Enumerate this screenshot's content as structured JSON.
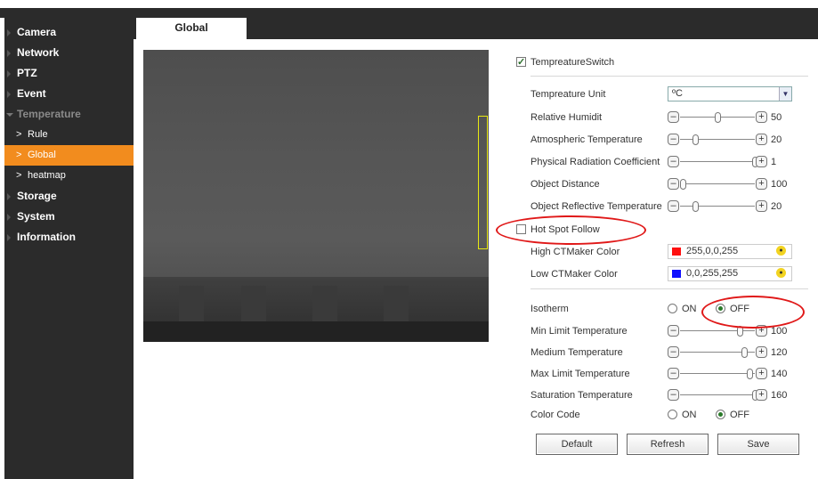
{
  "sidebar": {
    "items": [
      {
        "label": "Camera"
      },
      {
        "label": "Network"
      },
      {
        "label": "PTZ"
      },
      {
        "label": "Event"
      },
      {
        "label": "Temperature"
      }
    ],
    "sub_items": [
      {
        "label": "Rule"
      },
      {
        "label": "Global"
      },
      {
        "label": "heatmap"
      }
    ],
    "bottom_items": [
      {
        "label": "Storage"
      },
      {
        "label": "System"
      },
      {
        "label": "Information"
      }
    ]
  },
  "tabs": [
    {
      "label": "Global"
    }
  ],
  "settings": {
    "temperature_switch": {
      "label": "TempreatureSwitch",
      "checked": true
    },
    "temperature_unit": {
      "label": "Tempreature Unit",
      "value": "ºC"
    },
    "sliders_top": [
      {
        "label": "Relative Humidit",
        "value": "50",
        "level": 0.5
      },
      {
        "label": "Atmospheric Temperature",
        "value": "20",
        "level": 0.2
      },
      {
        "label": "Physical Radiation Coefficient",
        "value": "1",
        "level": 1.0
      },
      {
        "label": "Object Distance",
        "value": "100",
        "level": 0.04
      },
      {
        "label": "Object Reflective Temperature",
        "value": "20",
        "level": 0.2
      }
    ],
    "hot_spot_follow": {
      "label": "Hot Spot Follow",
      "checked": false
    },
    "high_color": {
      "label": "High CTMaker Color",
      "value": "255,0,0,255",
      "swatch": "#ff1010"
    },
    "low_color": {
      "label": "Low CTMaker Color",
      "value": "0,0,255,255",
      "swatch": "#1010ff"
    },
    "isotherm": {
      "label": "Isotherm",
      "on_label": "ON",
      "off_label": "OFF",
      "selected": "OFF"
    },
    "sliders_bottom": [
      {
        "label": "Min Limit Temperature",
        "value": "100",
        "level": 0.8
      },
      {
        "label": "Medium Temperature",
        "value": "120",
        "level": 0.86
      },
      {
        "label": "Max Limit Temperature",
        "value": "140",
        "level": 0.93
      },
      {
        "label": "Saturation Temperature",
        "value": "160",
        "level": 1.0
      }
    ],
    "color_code": {
      "label": "Color Code",
      "on_label": "ON",
      "off_label": "OFF",
      "selected": "OFF"
    }
  },
  "buttons": {
    "default": "Default",
    "refresh": "Refresh",
    "save": "Save"
  },
  "colors": {
    "accent": "#f28c1e",
    "sidebar_bg": "#2b2b2b",
    "highlight": "#e01818"
  }
}
